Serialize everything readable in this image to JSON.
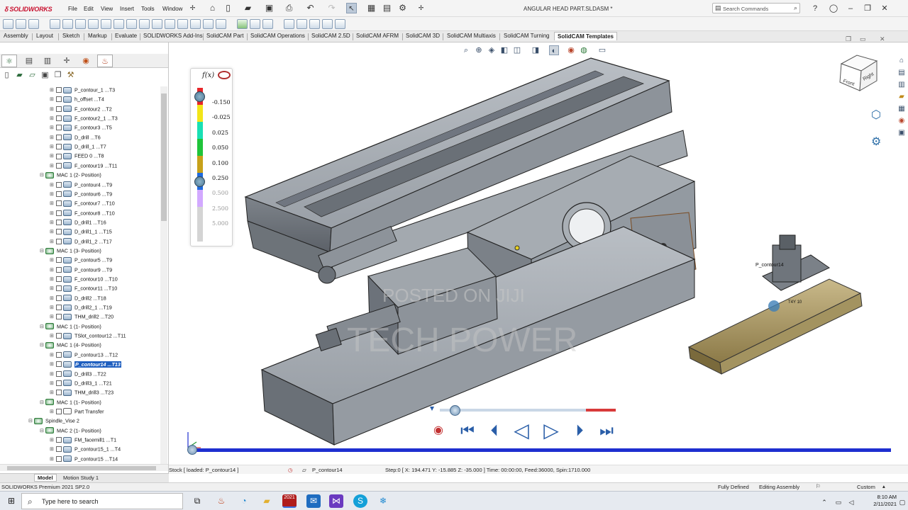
{
  "app": {
    "logo_text": "SOLIDWORKS",
    "doc_title": "ANGULAR HEAD PART.SLDASM *"
  },
  "menu": [
    "File",
    "Edit",
    "View",
    "Insert",
    "Tools",
    "Window"
  ],
  "search": {
    "placeholder": "Search Commands"
  },
  "tabs": [
    "Assembly",
    "Layout",
    "Sketch",
    "Markup",
    "Evaluate",
    "SOLIDWORKS Add-Ins",
    "SolidCAM Part",
    "SolidCAM Operations",
    "SolidCAM 2.5D",
    "SolidCAM AFRM",
    "SolidCAM 3D",
    "SolidCAM Multiaxis",
    "SolidCAM Turning",
    "SolidCAM Templates"
  ],
  "active_tab": "SolidCAM Templates",
  "tree": [
    {
      "label": "P_contour_1 ...T3",
      "level": 3,
      "type": "op"
    },
    {
      "label": "h_offset ...T4",
      "level": 3,
      "type": "op"
    },
    {
      "label": "F_contour2 ...T2",
      "level": 3,
      "type": "op"
    },
    {
      "label": "F_contour2_1 ...T3",
      "level": 3,
      "type": "op"
    },
    {
      "label": "F_contour3 ...T5",
      "level": 3,
      "type": "op"
    },
    {
      "label": "D_drill ...T6",
      "level": 3,
      "type": "op"
    },
    {
      "label": "D_drill_1 ...T7",
      "level": 3,
      "type": "op"
    },
    {
      "label": "FEED 0 ...T8",
      "level": 3,
      "type": "op"
    },
    {
      "label": "F_contour19 ...T11",
      "level": 3,
      "type": "op"
    },
    {
      "label": "MAC 1 (2- Position)",
      "level": 2,
      "type": "mac"
    },
    {
      "label": "P_contour4 ...T9",
      "level": 3,
      "type": "op"
    },
    {
      "label": "P_contour6 ...T9",
      "level": 3,
      "type": "op"
    },
    {
      "label": "F_contour7 ...T10",
      "level": 3,
      "type": "op"
    },
    {
      "label": "F_contour8 ...T10",
      "level": 3,
      "type": "op"
    },
    {
      "label": "D_drill1 ...T16",
      "level": 3,
      "type": "op"
    },
    {
      "label": "D_drill1_1 ...T15",
      "level": 3,
      "type": "op"
    },
    {
      "label": "D_drill1_2 ...T17",
      "level": 3,
      "type": "op"
    },
    {
      "label": "MAC 1 (3- Position)",
      "level": 2,
      "type": "mac"
    },
    {
      "label": "P_contour5 ...T9",
      "level": 3,
      "type": "op"
    },
    {
      "label": "P_contour9 ...T9",
      "level": 3,
      "type": "op"
    },
    {
      "label": "F_contour10 ...T10",
      "level": 3,
      "type": "op"
    },
    {
      "label": "F_contour11 ...T10",
      "level": 3,
      "type": "op"
    },
    {
      "label": "D_drill2 ...T18",
      "level": 3,
      "type": "op"
    },
    {
      "label": "D_drill2_1 ...T19",
      "level": 3,
      "type": "op"
    },
    {
      "label": "THM_drill2 ...T20",
      "level": 3,
      "type": "op"
    },
    {
      "label": "MAC 1 (1- Position)",
      "level": 2,
      "type": "mac"
    },
    {
      "label": "TSlot_contour12 ...T11",
      "level": 3,
      "type": "op"
    },
    {
      "label": "MAC 1 (4- Position)",
      "level": 2,
      "type": "mac"
    },
    {
      "label": "P_contour13 ...T12",
      "level": 3,
      "type": "op"
    },
    {
      "label": "P_contour14 ...T13",
      "level": 3,
      "type": "op",
      "selected": true
    },
    {
      "label": "D_drill3 ...T22",
      "level": 3,
      "type": "op"
    },
    {
      "label": "D_drill3_1 ...T21",
      "level": 3,
      "type": "op"
    },
    {
      "label": "THM_drill3 ...T23",
      "level": 3,
      "type": "op"
    },
    {
      "label": "MAC 1 (1- Position)",
      "level": 2,
      "type": "mac"
    },
    {
      "label": "Part Transfer",
      "level": 3,
      "type": "doc"
    },
    {
      "label": "Spindle_Vise 2",
      "level": 1,
      "type": "mac"
    },
    {
      "label": "MAC 2 (1- Position)",
      "level": 2,
      "type": "mac"
    },
    {
      "label": "FM_facemill1 ...T1",
      "level": 3,
      "type": "op"
    },
    {
      "label": "P_contour15_1 ...T4",
      "level": 3,
      "type": "op"
    },
    {
      "label": "P_contour15 ...T14",
      "level": 3,
      "type": "op"
    }
  ],
  "bottom_tabs": [
    "Model",
    "Motion Study 1"
  ],
  "legend": {
    "fx": "f(x)",
    "values": [
      "-0.150",
      "-0.025",
      "0.025",
      "0.050",
      "0.100",
      "0.250",
      "0.500",
      "2.500",
      "5.000"
    ],
    "colors": [
      "#e8262a",
      "#f2e519",
      "#19e0b4",
      "#1fc43a",
      "#c7a11a",
      "#1f6be0",
      "#d2a9ff",
      "#d4d4d4",
      "#d4d4d4"
    ]
  },
  "cube": {
    "front": "Front",
    "right": "Right"
  },
  "viewport_labels": {
    "small_part_label": "P_contour14",
    "small_tool_label": "T4Y 10"
  },
  "watermark": [
    "POSTED ON JIJI",
    "TECH POWER"
  ],
  "status": {
    "stock": "Stock [ loaded: P_contour14 ]",
    "op": "P_contour14",
    "step": "Step:0 [ X: 194.471 Y: -15.885 Z: -35.000 ] Time: 00:00:00, Feed:36000, Spin:1710.000"
  },
  "app_status": {
    "left": "SOLIDWORKS Premium 2021 SP2.0",
    "defined": "Fully Defined",
    "editing": "Editing Assembly",
    "units": "Custom"
  },
  "taskbar": {
    "search": "Type here to search",
    "time": "8:10 AM",
    "date": "2/11/2021",
    "sw_badge": "2021"
  },
  "colors": {
    "accent": "#1f5fbf",
    "sim_blue": "#1e2fd0",
    "progress_red": "#d83a3a"
  }
}
